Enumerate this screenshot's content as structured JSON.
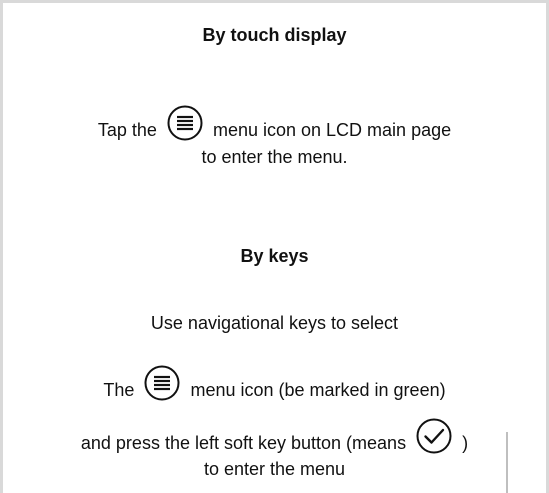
{
  "touch": {
    "heading": "By touch display",
    "line1_before": "Tap the",
    "line1_after": "menu icon on LCD main page",
    "line2": "to enter the menu."
  },
  "keys": {
    "heading": "By keys",
    "line1": "Use navigational keys to select",
    "line2_before": "The",
    "line2_after": "menu icon (be marked in green)",
    "line3_before": "and press the left soft key button (means",
    "line3_after": ")",
    "line4": "to enter the menu"
  },
  "icons": {
    "menu": "menu-icon",
    "check": "checkmark-icon"
  }
}
